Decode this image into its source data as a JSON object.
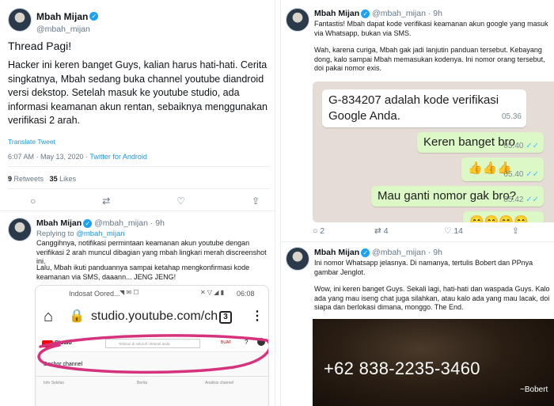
{
  "colors": {
    "accent": "#1da1f2",
    "link": "#1b95e0",
    "wa_out": "#dcf8c6",
    "wa_bg": "#e5ddd5",
    "circle": "#d6337f"
  },
  "main_tweet": {
    "name": "Mbah Mijan",
    "handle": "@mbah_mijan",
    "line1": "Thread Pagi!",
    "body": "Hacker ini keren banget Guys, kalian harus hati-hati. Cerita singkatnya, Mbah sedang buka channel youtube diandroid versi dekstop. Setelah masuk ke youtube studio, ada informasi keamanan akun rentan, sebaiknya menggunakan verifikasi 2 arah.",
    "translate": "Translate Tweet",
    "timestamp": "6:07 AM · May 13, 2020 · ",
    "client": "Twitter for Android",
    "retweets": "9",
    "retweets_label": "Retweets",
    "likes": "35",
    "likes_label": "Likes"
  },
  "reply1": {
    "name": "Mbah Mijan",
    "handle": "@mbah_mijan · 9h",
    "replying_prefix": "Replying to ",
    "replying_to": "@mbah_mijan",
    "p1": "Canggihnya, notifikasi permintaan keamanan akun youtube dengan verifikasi 2 arah muncul dibagian yang mbah lingkari merah discreenshot ini.",
    "p2": "Lalu, Mbah ikuti panduannya sampai ketahap mengkonfirmasi kode keamanan via SMS, daaann... JENG JENG!"
  },
  "phone": {
    "carrier": "Indosat Oored...",
    "time": "06:08",
    "url": "studio.youtube.com/ch",
    "tab_count": "3",
    "studio_label": "Studio",
    "search_placeholder": "Telusuri di seluruh channel anda",
    "create_label": "BUAT",
    "channel_label": "Dasbor channel",
    "col1": "Info Sekilas",
    "col2": "Berita",
    "col3": "Analisis channel"
  },
  "reply2": {
    "name": "Mbah Mijan",
    "handle": "@mbah_mijan · 9h",
    "p1": "Fantastis! Mbah dapat kode verifikasi keamanan akun google yang masuk via Whatsapp, bukan via SMS.",
    "p2": "Wah, karena curiga, Mbah gak jadi lanjutin panduan tersebut. Kebayang dong, kalo sampai Mbah memasukan kodenya. Ini nomor orang tersebut, doi pakai nomor exis.",
    "reply_count": "2",
    "rt_count": "4",
    "like_count": "14"
  },
  "chat": {
    "m1_text": "G-834207 adalah kode verifikasi Google Anda.",
    "m1_time": "05.36",
    "m2_text": "Keren banget bro",
    "m2_time": "05.40",
    "m3_text": "👍👍👍",
    "m3_time": "05.40",
    "m4_text": "Mau ganti nomor gak bro?",
    "m4_time": "05.42",
    "m5_text": "😄😄😄😄"
  },
  "reply3": {
    "name": "Mbah Mijan",
    "handle": "@mbah_mijan · 9h",
    "p1": "Ini nomor Whatsapp jelasnya. Di namanya, tertulis Bobert dan PPnya gambar Jenglot.",
    "p2": "Wow, ini keren banget Guys. Sekali lagi, hati-hati dan waspada Guys. Kalo ada yang mau iseng chat juga silahkan, atau kalo ada yang mau lacak, doi siapa dan berlokasi dimana, monggo. The End.",
    "phone_number": "+62 838-2235-3460",
    "caption": "~Bobert"
  }
}
